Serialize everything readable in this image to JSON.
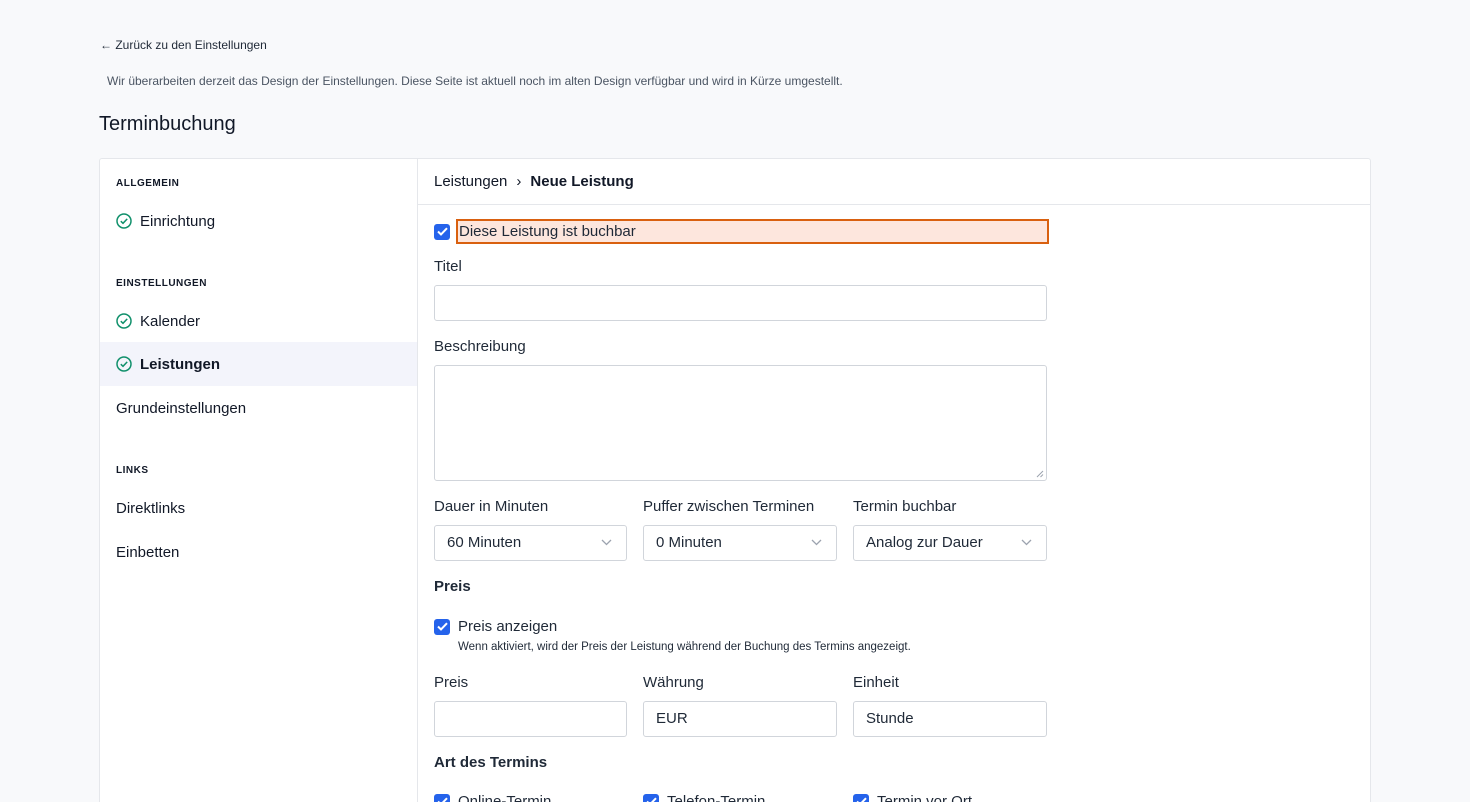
{
  "nav": {
    "back_label": "← Zurück zu den Einstellungen"
  },
  "notice": "Wir überarbeiten derzeit das Design der Einstellungen. Diese Seite ist aktuell noch im alten Design verfügbar und wird in Kürze umgestellt.",
  "page_title": "Terminbuchung",
  "sidebar": {
    "sections": [
      {
        "title": "ALLGEMEIN",
        "items": [
          {
            "label": "Einrichtung",
            "done": true
          }
        ]
      },
      {
        "title": "EINSTELLUNGEN",
        "items": [
          {
            "label": "Kalender",
            "done": true
          },
          {
            "label": "Leistungen",
            "done": true,
            "active": true
          },
          {
            "label": "Grundeinstellungen",
            "done": false
          }
        ]
      },
      {
        "title": "LINKS",
        "items": [
          {
            "label": "Direktlinks",
            "done": false
          },
          {
            "label": "Einbetten",
            "done": false
          }
        ]
      }
    ]
  },
  "breadcrumb": {
    "parent": "Leistungen",
    "separator": "›",
    "current": "Neue Leistung"
  },
  "form": {
    "bookable_label": "Diese Leistung ist buchbar",
    "title_label": "Titel",
    "title_value": "",
    "description_label": "Beschreibung",
    "duration_label": "Dauer in Minuten",
    "duration_value": "60 Minuten",
    "buffer_label": "Puffer zwischen Terminen",
    "buffer_value": "0 Minuten",
    "bookable_when_label": "Termin buchbar",
    "bookable_when_value": "Analog zur Dauer",
    "price_section": "Preis",
    "show_price_label": "Preis anzeigen",
    "show_price_hint": "Wenn aktiviert, wird der Preis der Leistung während der Buchung des Termins angezeigt.",
    "price_label": "Preis",
    "price_value": "",
    "currency_label": "Währung",
    "currency_value": "EUR",
    "unit_label": "Einheit",
    "unit_value": "Stunde",
    "type_section": "Art des Termins",
    "type_online": "Online-Termin",
    "type_phone": "Telefon-Termin",
    "type_onsite": "Termin vor Ort"
  },
  "colors": {
    "accent": "#2563eb",
    "success": "#10906b",
    "highlight_border": "#d9600f",
    "highlight_bg": "#fde6dd"
  }
}
